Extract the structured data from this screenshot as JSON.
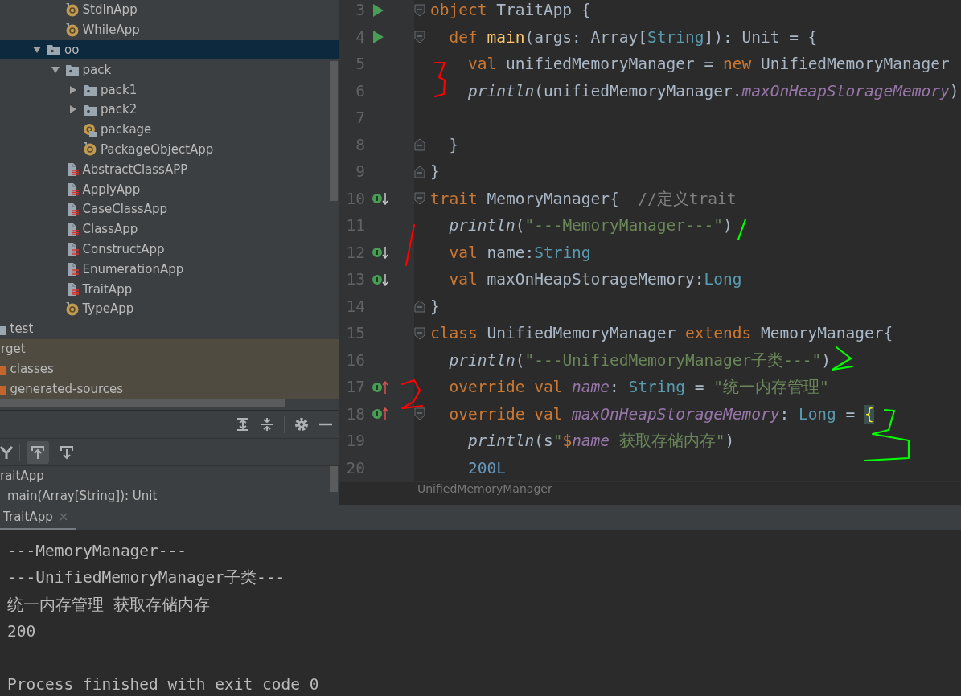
{
  "project_tree": {
    "items": [
      {
        "children": [
          {
            "children": [
              {
                "children": [
                  {
                    "children": [
                      {
                        "children": [
                          {
                            "label": "StdInApp",
                            "kind": "object",
                            "selected": false,
                            "excluded": false
                          },
                          {
                            "label": "WhileApp",
                            "kind": "object",
                            "selected": false,
                            "excluded": false
                          }
                        ]
                      },
                      {
                        "label": "oo",
                        "kind": "package",
                        "expanded": true,
                        "selected": true,
                        "excluded": false,
                        "children": [
                          {
                            "label": "pack",
                            "kind": "package",
                            "expanded": true,
                            "selected": false,
                            "excluded": false,
                            "children": [
                              {
                                "label": "pack1",
                                "kind": "package",
                                "expanded": false,
                                "selected": false,
                                "excluded": false
                              },
                              {
                                "label": "pack2",
                                "kind": "package",
                                "expanded": false,
                                "selected": false,
                                "excluded": false
                              },
                              {
                                "label": "package",
                                "kind": "package-object",
                                "selected": false,
                                "excluded": false
                              },
                              {
                                "label": "PackageObjectApp",
                                "kind": "object",
                                "selected": false,
                                "excluded": false
                              }
                            ]
                          },
                          {
                            "label": "AbstractClassAPP",
                            "kind": "class",
                            "selected": false,
                            "excluded": false
                          },
                          {
                            "label": "ApplyApp",
                            "kind": "class",
                            "selected": false,
                            "excluded": false
                          },
                          {
                            "label": "CaseClassApp",
                            "kind": "class",
                            "selected": false,
                            "excluded": false
                          },
                          {
                            "label": "ClassApp",
                            "kind": "class",
                            "selected": false,
                            "excluded": false
                          },
                          {
                            "label": "ConstructApp",
                            "kind": "class",
                            "selected": false,
                            "excluded": false
                          },
                          {
                            "label": "EnumerationApp",
                            "kind": "class",
                            "selected": false,
                            "excluded": false
                          },
                          {
                            "label": "TraitApp",
                            "kind": "class",
                            "selected": false,
                            "excluded": false
                          },
                          {
                            "label": "TypeApp",
                            "kind": "object",
                            "selected": false,
                            "excluded": false
                          }
                        ]
                      }
                    ]
                  }
                ]
              }
            ]
          },
          {
            "label": "test",
            "kind": "folder",
            "selected": false,
            "excluded": false
          }
        ]
      },
      {
        "label": "rget",
        "selected": false,
        "excluded": true,
        "children": [
          {
            "label": "classes",
            "kind": "output-folder",
            "selected": false,
            "excluded": true
          },
          {
            "label": "generated-sources",
            "kind": "output-folder",
            "selected": false,
            "excluded": true
          }
        ]
      }
    ]
  },
  "structure": {
    "toggles": [
      {
        "selected": true
      },
      {
        "selected": false
      }
    ],
    "items": [
      {
        "label": "raitApp",
        "children": [
          {
            "label": "main(Array[String]): Unit"
          }
        ]
      }
    ]
  },
  "editor": {
    "lines": [
      {
        "number": "3",
        "gutter_icons": [
          {
            "kind": "run"
          },
          {
            "kind": "fold-start"
          }
        ],
        "tokens": [
          {
            "kind": "keyword",
            "text": "object"
          },
          {
            "kind": "plain",
            "text": " TraitApp {"
          }
        ]
      },
      {
        "number": "4",
        "gutter_icons": [
          {
            "kind": "run"
          },
          {
            "kind": "fold-start"
          }
        ],
        "tokens": [
          {
            "kind": "keyword",
            "text": "  def"
          },
          {
            "kind": "function",
            "text": " main"
          },
          {
            "kind": "plain",
            "text": "(args: Array["
          },
          {
            "kind": "type",
            "text": "String"
          },
          {
            "kind": "plain",
            "text": "]): Unit = {"
          }
        ]
      },
      {
        "number": "5",
        "tokens": [
          {
            "kind": "keyword",
            "text": "    val"
          },
          {
            "kind": "plain",
            "text": " unifiedMemoryManager = "
          },
          {
            "kind": "keyword",
            "text": "new"
          },
          {
            "kind": "plain",
            "text": " UnifiedMemoryManager"
          }
        ]
      },
      {
        "number": "6",
        "tokens": [
          {
            "kind": "call",
            "text": "    println"
          },
          {
            "kind": "plain",
            "text": "(unifiedMemoryManager."
          },
          {
            "kind": "field",
            "text": "maxOnHeapStorageMemory"
          },
          {
            "kind": "plain",
            "text": ")"
          }
        ]
      },
      {
        "number": "7"
      },
      {
        "number": "8",
        "gutter_icons": [
          {
            "kind": "fold-end"
          }
        ],
        "tokens": [
          {
            "kind": "plain",
            "text": "  }"
          }
        ]
      },
      {
        "number": "9",
        "gutter_icons": [
          {
            "kind": "fold-end"
          }
        ],
        "tokens": [
          {
            "kind": "plain",
            "text": "}"
          }
        ]
      },
      {
        "number": "10",
        "gutter_icons": [
          {
            "kind": "implemented"
          },
          {
            "kind": "fold-start"
          }
        ],
        "tokens": [
          {
            "kind": "keyword",
            "text": "trait"
          },
          {
            "kind": "plain",
            "text": " MemoryManager{  "
          },
          {
            "kind": "comment",
            "text": "//定义trait"
          }
        ]
      },
      {
        "number": "11",
        "tokens": [
          {
            "kind": "call",
            "text": "  println"
          },
          {
            "kind": "plain",
            "text": "("
          },
          {
            "kind": "string",
            "text": "\"---MemoryManager---\""
          },
          {
            "kind": "plain",
            "text": ")"
          }
        ]
      },
      {
        "number": "12",
        "gutter_icons": [
          {
            "kind": "implemented"
          }
        ],
        "tokens": [
          {
            "kind": "keyword",
            "text": "  val"
          },
          {
            "kind": "plain",
            "text": " name:"
          },
          {
            "kind": "type",
            "text": "String"
          }
        ]
      },
      {
        "number": "13",
        "gutter_icons": [
          {
            "kind": "implemented"
          }
        ],
        "tokens": [
          {
            "kind": "keyword",
            "text": "  val"
          },
          {
            "kind": "plain",
            "text": " maxOnHeapStorageMemory:"
          },
          {
            "kind": "type",
            "text": "Long"
          }
        ]
      },
      {
        "number": "14",
        "gutter_icons": [
          {
            "kind": "fold-end"
          }
        ],
        "tokens": [
          {
            "kind": "plain",
            "text": "}"
          }
        ]
      },
      {
        "number": "15",
        "gutter_icons": [
          {
            "kind": "fold-start"
          }
        ],
        "tokens": [
          {
            "kind": "keyword",
            "text": "class"
          },
          {
            "kind": "plain",
            "text": " UnifiedMemoryManager "
          },
          {
            "kind": "keyword",
            "text": "extends"
          },
          {
            "kind": "plain",
            "text": " MemoryManager{"
          }
        ]
      },
      {
        "number": "16",
        "tokens": [
          {
            "kind": "call",
            "text": "  println"
          },
          {
            "kind": "plain",
            "text": "("
          },
          {
            "kind": "string",
            "text": "\"---UnifiedMemoryManager子类---\""
          },
          {
            "kind": "plain",
            "text": ")"
          }
        ]
      },
      {
        "number": "17",
        "gutter_icons": [
          {
            "kind": "overriding"
          }
        ],
        "tokens": [
          {
            "kind": "keyword",
            "text": "  override val"
          },
          {
            "kind": "field",
            "text": " name"
          },
          {
            "kind": "plain",
            "text": ": "
          },
          {
            "kind": "type",
            "text": "String"
          },
          {
            "kind": "plain",
            "text": " = "
          },
          {
            "kind": "string",
            "text": "\"统一内存管理\""
          }
        ]
      },
      {
        "number": "18",
        "gutter_icons": [
          {
            "kind": "overriding"
          },
          {
            "kind": "fold-start"
          }
        ],
        "tokens": [
          {
            "kind": "keyword",
            "text": "  override val"
          },
          {
            "kind": "field",
            "text": " maxOnHeapStorageMemory"
          },
          {
            "kind": "plain",
            "text": ": "
          },
          {
            "kind": "type",
            "text": "Long"
          },
          {
            "kind": "plain",
            "text": " = "
          },
          {
            "kind": "brace",
            "text": "{"
          }
        ]
      },
      {
        "number": "19",
        "tokens": [
          {
            "kind": "call",
            "text": "    println"
          },
          {
            "kind": "plain",
            "text": "(s"
          },
          {
            "kind": "string",
            "text": "\""
          },
          {
            "kind": "keyword",
            "text": "$"
          },
          {
            "kind": "field",
            "text": "name"
          },
          {
            "kind": "string",
            "text": " 获取存储内存\""
          },
          {
            "kind": "plain",
            "text": ")"
          }
        ]
      },
      {
        "number": "20",
        "tokens": [
          {
            "kind": "number",
            "text": "    200L"
          }
        ]
      }
    ],
    "annotations": [
      {
        "color": "#ff0000"
      },
      {
        "color": "#ff0000"
      },
      {
        "color": "#00ff00"
      },
      {
        "color": "#00ff00"
      },
      {
        "color": "#ff0000"
      },
      {
        "color": "#00ff00"
      }
    ],
    "breadcrumb": "UnifiedMemoryManager"
  },
  "run_console": {
    "tab": {
      "label": "TraitApp",
      "selected": true
    },
    "lines": [
      {
        "kind": "output",
        "text": "---MemoryManager---"
      },
      {
        "kind": "output",
        "text": "---UnifiedMemoryManager子类---"
      },
      {
        "kind": "output",
        "text": "统一内存管理 获取存储内存"
      },
      {
        "kind": "output",
        "text": "200"
      },
      {
        "kind": "exit",
        "text": "Process finished with exit code 0"
      }
    ]
  }
}
